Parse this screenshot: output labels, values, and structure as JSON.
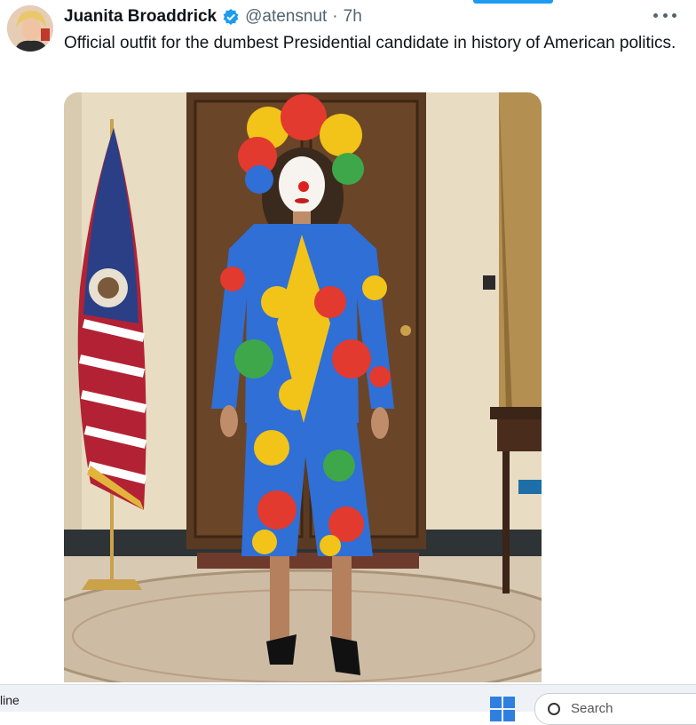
{
  "tweet": {
    "display_name": "Juanita Broaddrick",
    "handle": "@atensnut",
    "separator": "·",
    "time": "7h",
    "text": "Official outfit for the dumbest Presidential candidate in history of American politics."
  },
  "icons": {
    "verified": "verified-badge-icon",
    "more": "more-options-icon",
    "windows": "windows-start-icon",
    "search": "search-icon"
  },
  "colors": {
    "accent": "#1d9bf0",
    "text": "#0f1419",
    "secondary_text": "#536471"
  },
  "taskbar": {
    "left_label": "line",
    "search_placeholder": "Search"
  }
}
